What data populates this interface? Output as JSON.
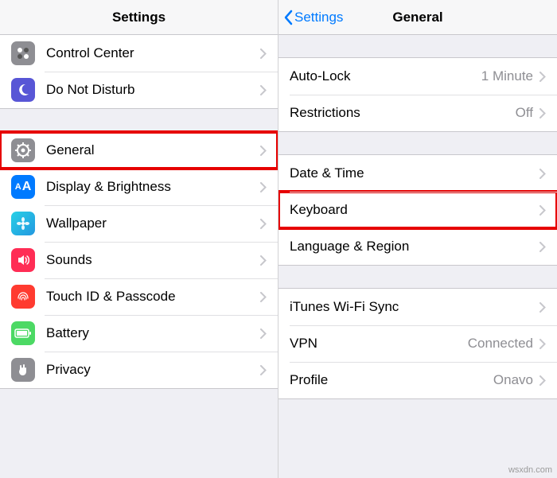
{
  "watermark": "wsxdn.com",
  "left": {
    "title": "Settings",
    "rows": {
      "control_center": "Control Center",
      "dnd": "Do Not Disturb",
      "general": "General",
      "display": "Display & Brightness",
      "wallpaper": "Wallpaper",
      "sounds": "Sounds",
      "touchid": "Touch ID & Passcode",
      "battery": "Battery",
      "privacy": "Privacy"
    }
  },
  "right": {
    "back_label": "Settings",
    "title": "General",
    "rows": {
      "autolock": {
        "label": "Auto-Lock",
        "value": "1 Minute"
      },
      "restrictions": {
        "label": "Restrictions",
        "value": "Off"
      },
      "datetime": {
        "label": "Date & Time"
      },
      "keyboard": {
        "label": "Keyboard"
      },
      "langregion": {
        "label": "Language & Region"
      },
      "itunes": {
        "label": "iTunes Wi-Fi Sync"
      },
      "vpn": {
        "label": "VPN",
        "value": "Connected"
      },
      "profile": {
        "label": "Profile",
        "value": "Onavo"
      }
    }
  }
}
